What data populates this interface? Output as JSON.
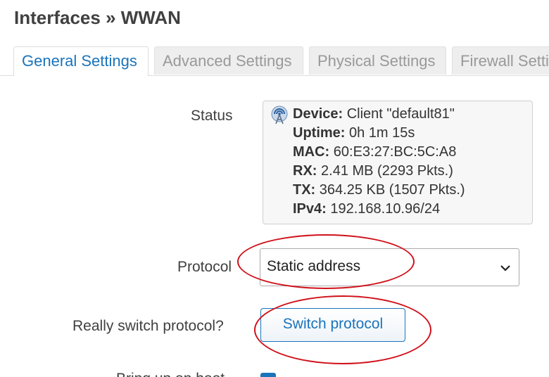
{
  "page": {
    "title": "Interfaces » WWAN"
  },
  "tabs": [
    {
      "label": "General Settings",
      "active": true
    },
    {
      "label": "Advanced Settings",
      "active": false
    },
    {
      "label": "Physical Settings",
      "active": false
    },
    {
      "label": "Firewall Setti",
      "active": false
    }
  ],
  "status": {
    "label": "Status",
    "icon": "wifi-antenna-icon",
    "lines": [
      {
        "key": "Device:",
        "value": " Client \"default81\""
      },
      {
        "key": "Uptime:",
        "value": " 0h 1m 15s"
      },
      {
        "key": "MAC:",
        "value": " 60:E3:27:BC:5C:A8"
      },
      {
        "key": "RX:",
        "value": " 2.41 MB (2293 Pkts.)"
      },
      {
        "key": "TX:",
        "value": " 364.25 KB (1507 Pkts.)"
      },
      {
        "key": "IPv4:",
        "value": " 192.168.10.96/24"
      }
    ]
  },
  "protocol": {
    "label": "Protocol",
    "selected": "Static address"
  },
  "switch": {
    "label": "Really switch protocol?",
    "button_label": "Switch protocol"
  },
  "next_row": {
    "label": "Bring up on boot"
  },
  "colors": {
    "accent": "#1a74bb",
    "annotation": "#d0101a"
  }
}
